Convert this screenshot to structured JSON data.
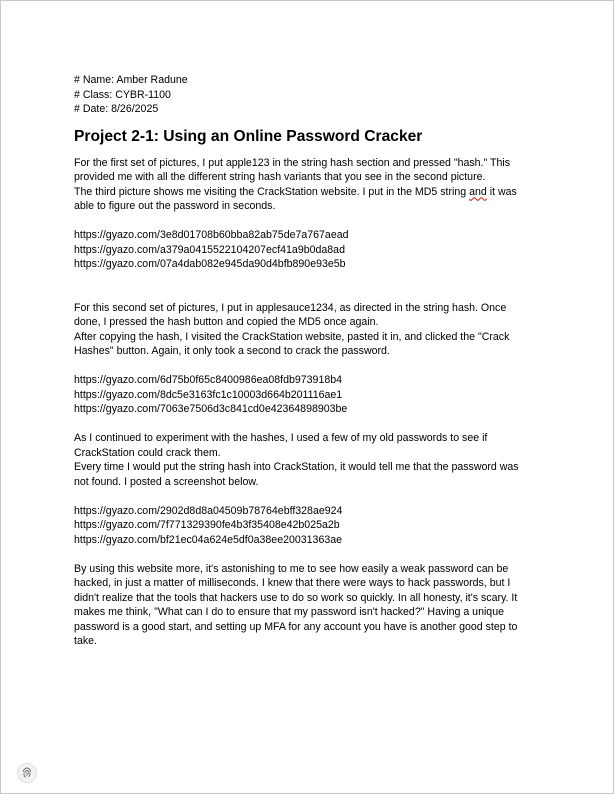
{
  "header": {
    "name": "# Name: Amber Radune",
    "class": "# Class: CYBR-1100",
    "date": "# Date: 8/26/2025"
  },
  "title": "Project 2-1: Using an Online Password Cracker",
  "section1": {
    "lines": [
      "For the first set of pictures, I put apple123 in the string hash section and pressed \"hash.\" This",
      "provided me with all the different string hash variants that you see in the second picture.",
      "The third picture shows me visiting the CrackStation website. I put in the MD5 string ",
      "able to figure out the password in seconds."
    ],
    "underlined_word": "and",
    "line3_tail": " it was",
    "links": [
      "https://gyazo.com/3e8d01708b60bba82ab75de7a767aead",
      "https://gyazo.com/a379a0415522104207ecf41a9b0da8ad",
      "https://gyazo.com/07a4dab082e945da90d4bfb890e93e5b"
    ]
  },
  "section2": {
    "lines": [
      "For this second set of pictures, I put in applesauce1234, as directed in the string hash. Once",
      "done, I pressed the hash button and copied the MD5 once again.",
      "After copying the hash, I visited the CrackStation website, pasted it in, and clicked the \"Crack",
      "Hashes\" button. Again, it only took a second to crack the password."
    ],
    "links": [
      "https://gyazo.com/6d75b0f65c8400986ea08fdb973918b4",
      "https://gyazo.com/8dc5e3163fc1c10003d664b201116ae1",
      "https://gyazo.com/7063e7506d3c841cd0e42364898903be"
    ]
  },
  "section3": {
    "lines": [
      "As I continued to experiment with the hashes, I used a few of my old passwords to see if",
      "CrackStation could crack them.",
      "Every time I would put the string hash into CrackStation, it would tell me that the password was",
      "not found. I posted a screenshot below."
    ],
    "links": [
      "https://gyazo.com/2902d8d8a04509b78764ebff328ae924",
      "https://gyazo.com/7f771329390fe4b3f35408e42b025a2b",
      "https://gyazo.com/bf21ec04a624e5df0a38ee20031363ae"
    ]
  },
  "conclusion": {
    "lines": [
      "By using this website more, it's astonishing to me to see how easily a weak password can be",
      "hacked, in just a matter of milliseconds. I knew that there were ways to hack passwords, but I",
      "didn't realize that the tools that hackers use to do so work so quickly. In all honesty, it's scary. It",
      "makes me think, \"What can I do to ensure that my password isn't hacked?\" Having a unique",
      "password is a good start, and setting up MFA for any account you have is another good step to",
      "take."
    ]
  },
  "icons": {
    "fab": "fingerprint-icon"
  }
}
